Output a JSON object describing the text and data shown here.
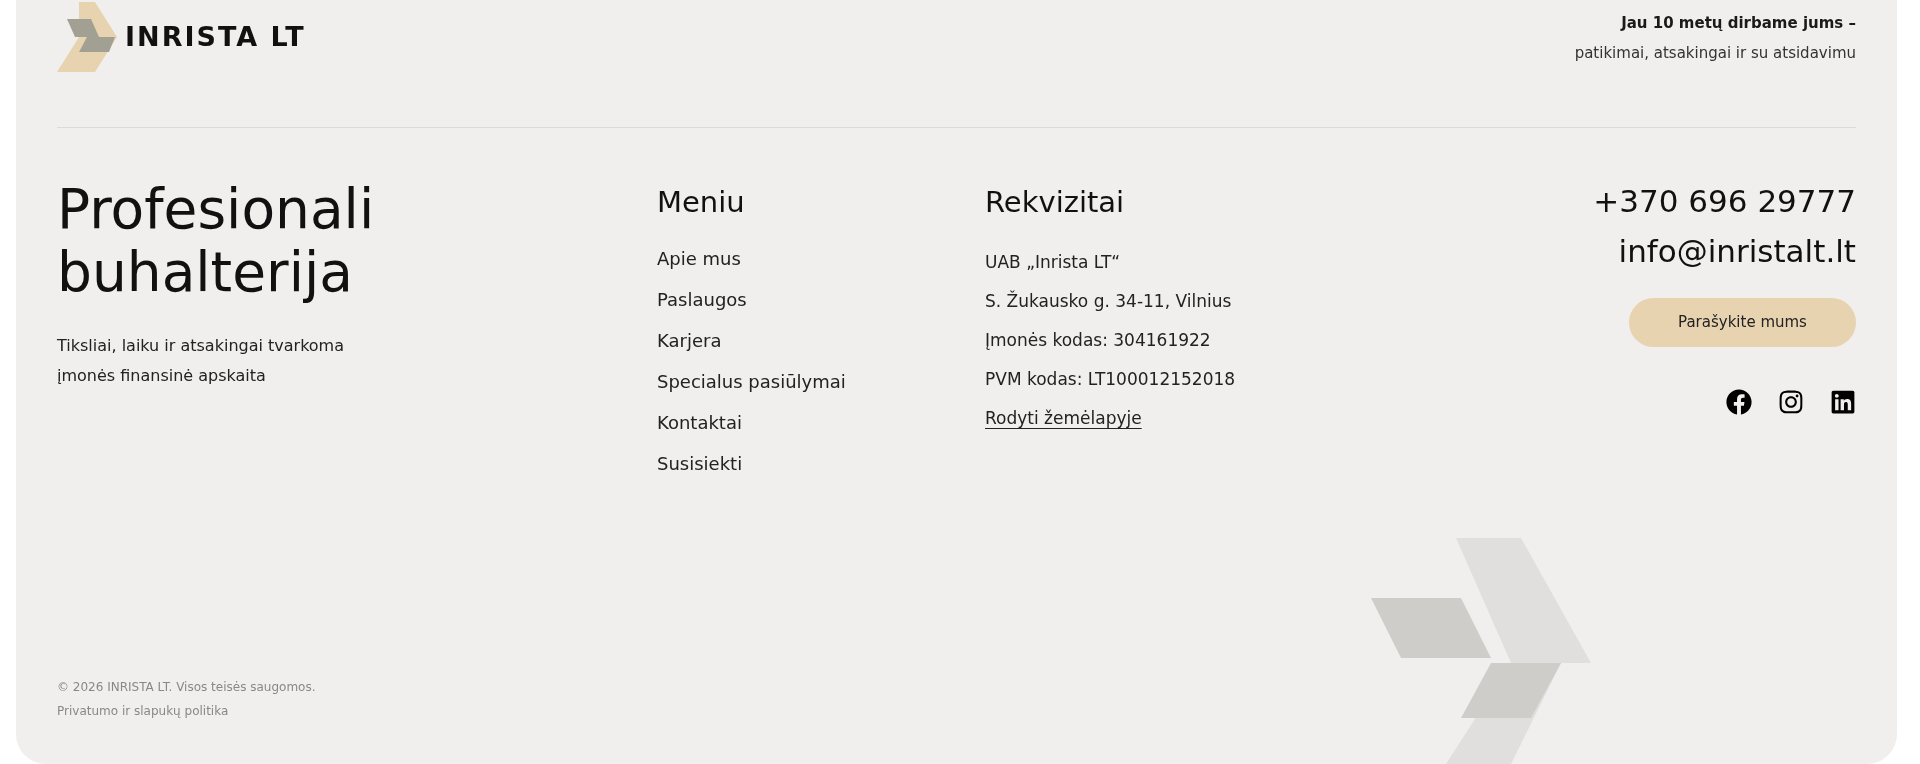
{
  "logo": {
    "text": "INRISTA LT"
  },
  "tagline": {
    "bold": "Jau 10 metų dirbame jums –",
    "text": "patikimai, atsakingai ir su atsidavimu"
  },
  "headline": {
    "title": "Profesionali buhalterija",
    "description": "Tiksliai, laiku ir atsakingai tvarkoma įmonės finansinė apskaita"
  },
  "menu": {
    "title": "Meniu",
    "items": [
      "Apie mus",
      "Paslaugos",
      "Karjera",
      "Specialus pasiūlymai",
      "Kontaktai",
      "Susisiekti"
    ]
  },
  "details": {
    "title": "Rekvizitai",
    "lines": [
      "UAB „Inrista LT“",
      "S. Žukausko g. 34-11, Vilnius",
      "Įmonės kodas: 304161922",
      "PVM kodas: LT100012152018"
    ],
    "map_link": "Rodyti žemėlapyje"
  },
  "contact": {
    "phone": "+370 696 29777",
    "email": "info@inristalt.lt",
    "button": "Parašykite mums",
    "social": [
      {
        "kind": "facebook"
      },
      {
        "kind": "instagram"
      },
      {
        "kind": "linkedin"
      }
    ]
  },
  "footer": {
    "copyright": "© 2026 INRISTA LT. Visos teisės saugomos.",
    "privacy": "Privatumo ir slapukų politika"
  }
}
